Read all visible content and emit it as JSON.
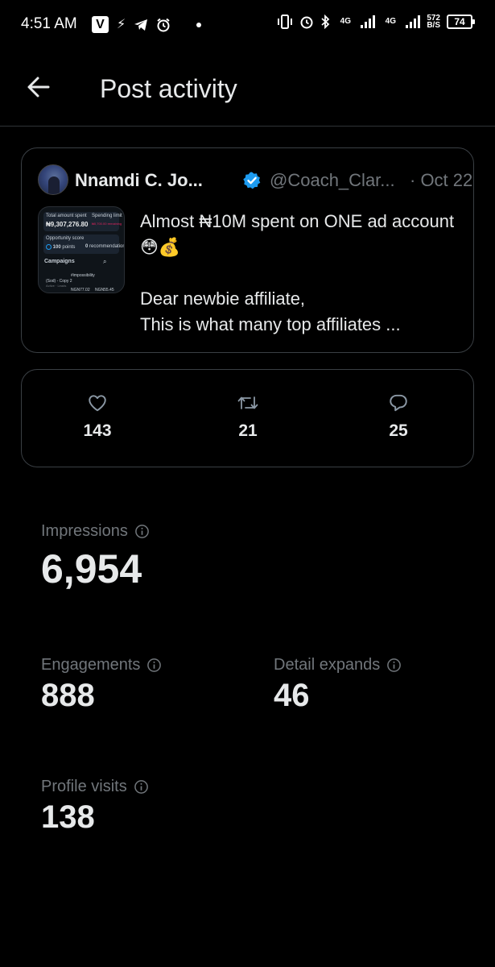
{
  "status_bar": {
    "time": "4:51 AM",
    "net1": "4G",
    "net2": "4G",
    "speed_value": "572",
    "speed_unit": "B/S",
    "battery": "74"
  },
  "header": {
    "title": "Post activity"
  },
  "tweet": {
    "author_name": "Nnamdi C. Jo...",
    "handle": "@Coach_Clar...",
    "date": "· Oct 22",
    "text": "Almost ₦10M spent on ONE ad account 😳💰\n\nDear newbie affiliate,\nThis is what many top affiliates ...",
    "thumbnail": {
      "label_total": "Total amount spent",
      "label_spending": "Spending limit",
      "amount": "₦9,307,276.80",
      "remaining": "₦0,700.00 remaining",
      "label_opportunity": "Opportunity score",
      "score": "100",
      "score_unit": "points",
      "recommendations": "0",
      "recommendations_unit": "recommendations",
      "campaigns": "Campaigns",
      "campaign_name": "#impossibility",
      "campaign_sub": "(Sod) - Copy 2",
      "campaign_status": "Active · Leads",
      "cost1": "NGN77.02",
      "cost2": "NGN55.45"
    }
  },
  "engagement": {
    "likes": "143",
    "retweets": "21",
    "replies": "25"
  },
  "metrics": {
    "impressions_label": "Impressions",
    "impressions_value": "6,954",
    "engagements_label": "Engagements",
    "engagements_value": "888",
    "detail_expands_label": "Detail expands",
    "detail_expands_value": "46",
    "profile_visits_label": "Profile visits",
    "profile_visits_value": "138"
  },
  "colors": {
    "background": "#000000",
    "text_primary": "#e7e9ea",
    "text_secondary": "#71767b",
    "verified_blue": "#1d9bf0",
    "border": "#3a3f44"
  },
  "icons": [
    "back-arrow-icon",
    "verified-badge-icon",
    "heart-icon",
    "retweet-icon",
    "reply-icon",
    "info-icon"
  ]
}
